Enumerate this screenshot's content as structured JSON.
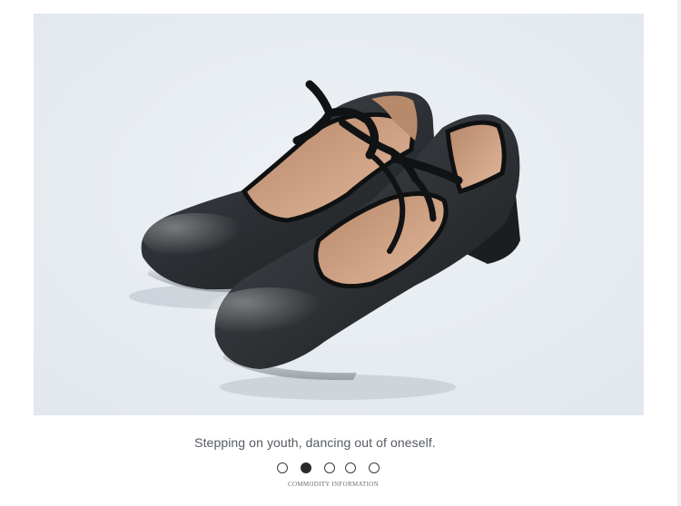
{
  "product": {
    "image_alt": "Black leather tap shoes with ribbon laces",
    "tagline": "Stepping on youth, dancing out of oneself.",
    "caption": "COMMODITY INFORMATION"
  },
  "carousel": {
    "slide_count": 5,
    "active_index": 1,
    "dots": [
      {
        "label": "slide-1",
        "active": false
      },
      {
        "label": "slide-2",
        "active": true
      },
      {
        "label": "slide-3",
        "active": false
      },
      {
        "label": "slide-4",
        "active": false
      },
      {
        "label": "slide-5",
        "active": false
      }
    ]
  },
  "colors": {
    "photo_background": "#e8edf2",
    "shoe_leather": "#2b2e31",
    "shoe_lining": "#c9987a",
    "dot_active": "#2a2a2a"
  }
}
